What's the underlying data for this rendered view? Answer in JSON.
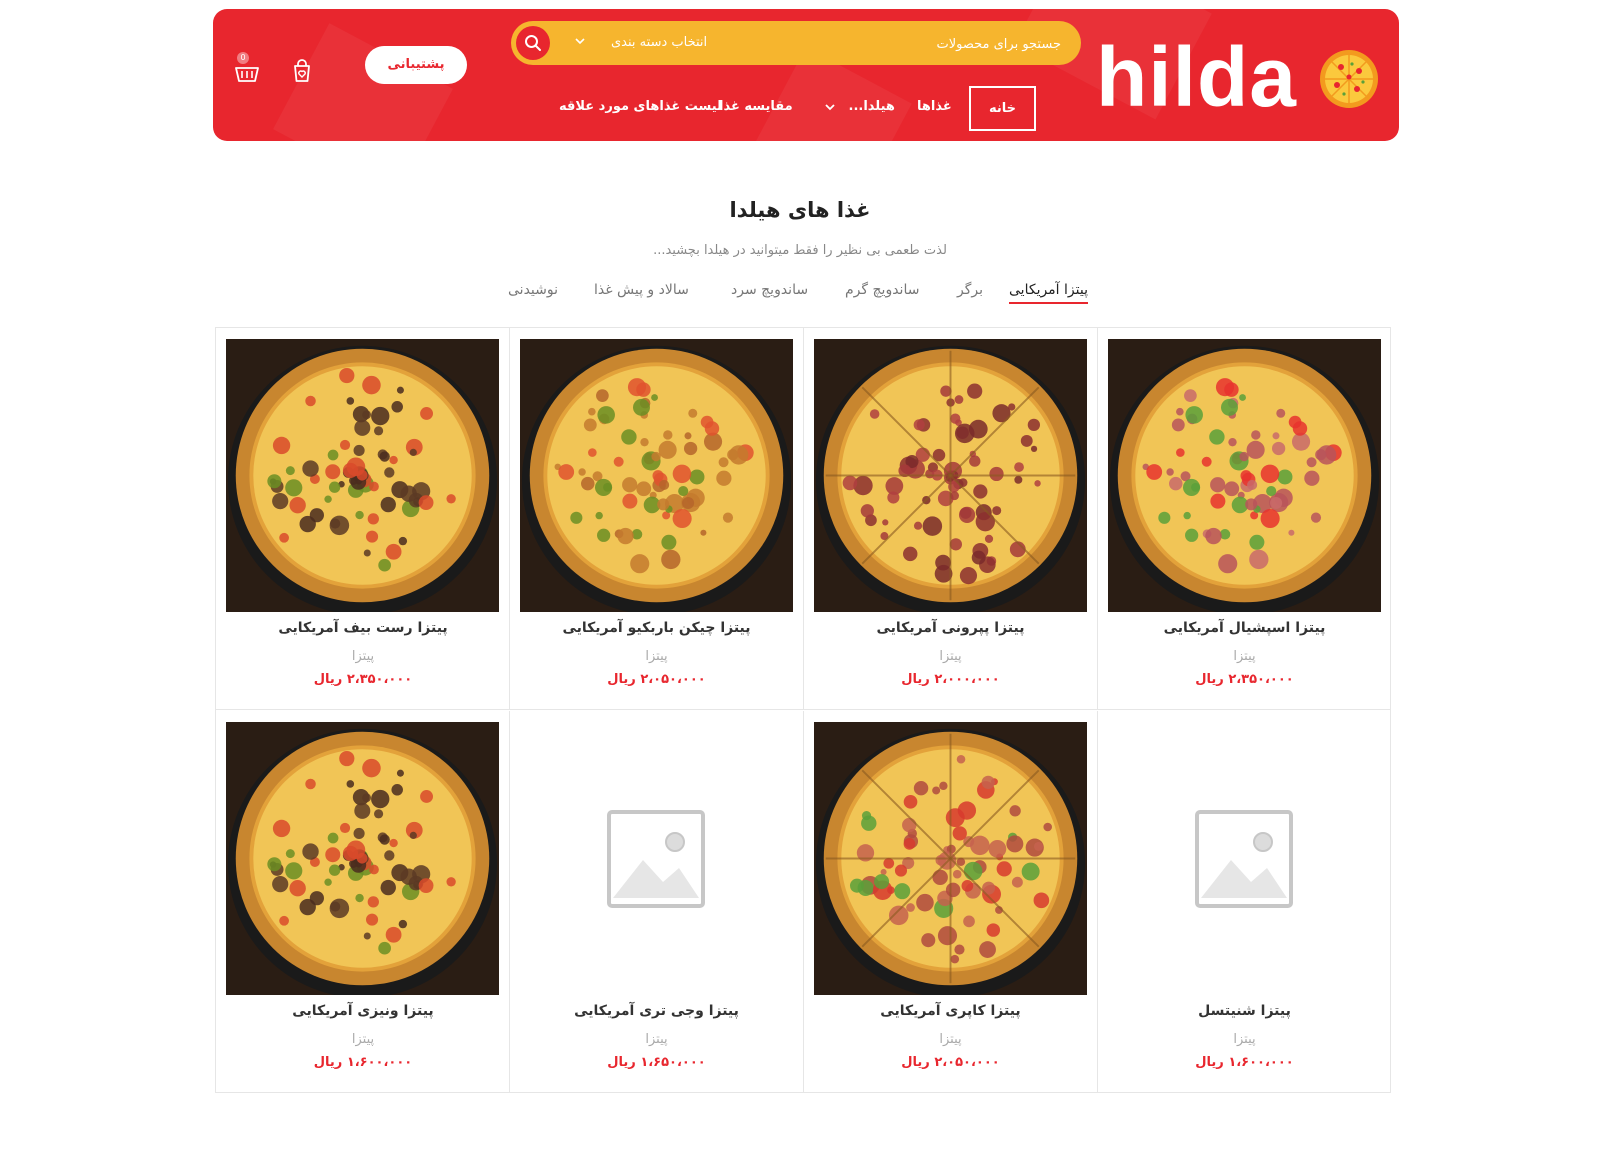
{
  "header": {
    "logo_text": "hilda",
    "search": {
      "placeholder": "جستجو برای محصولات",
      "category_label": "انتخاب دسته بندی"
    },
    "nav": [
      {
        "label": "خانه",
        "active": true
      },
      {
        "label": "غذاها"
      },
      {
        "label": "هیلدا..."
      },
      {
        "label": "مقایسه غذا"
      },
      {
        "label": "لیست غذاهای مورد علاقه"
      }
    ],
    "support_label": "پشتیبانی",
    "cart_count": "0"
  },
  "section": {
    "title": "غذا های هیلدا",
    "subtitle": "لذت طعمی بی نظیر را فقط میتوانید در هیلدا بچشید..."
  },
  "tabs": [
    {
      "label": "پیتزا آمریکایی",
      "active": true
    },
    {
      "label": "برگر"
    },
    {
      "label": "ساندویچ گرم"
    },
    {
      "label": "ساندویچ سرد"
    },
    {
      "label": "سالاد و پیش غذا"
    },
    {
      "label": "نوشیدنی"
    }
  ],
  "products": [
    {
      "title": "پیتزا اسپشیال آمریکایی",
      "category": "پیتزا",
      "price": "۲،۳۵۰،۰۰۰ ریال",
      "image": "pizza-special"
    },
    {
      "title": "پیتزا پپرونی آمریکایی",
      "category": "پیتزا",
      "price": "۲،۰۰۰،۰۰۰ ریال",
      "image": "pizza-pepperoni"
    },
    {
      "title": "پیتزا چیکن باربکیو آمریکایی",
      "category": "پیتزا",
      "price": "۲،۰۵۰،۰۰۰ ریال",
      "image": "pizza-chicken"
    },
    {
      "title": "پیتزا رست بیف آمریکایی",
      "category": "پیتزا",
      "price": "۲،۳۵۰،۰۰۰ ریال",
      "image": "pizza-beef"
    },
    {
      "title": "پیتزا شنیتسل",
      "category": "پیتزا",
      "price": "۱،۶۰۰،۰۰۰ ریال",
      "image": "placeholder"
    },
    {
      "title": "پیتزا کاپری آمریکایی",
      "category": "پیتزا",
      "price": "۲،۰۵۰،۰۰۰ ریال",
      "image": "pizza-capri"
    },
    {
      "title": "پیتزا وجی تری آمریکایی",
      "category": "پیتزا",
      "price": "۱،۶۵۰،۰۰۰ ریال",
      "image": "placeholder"
    },
    {
      "title": "پیتزا ونیزی آمریکایی",
      "category": "پیتزا",
      "price": "۱،۶۰۰،۰۰۰ ریال",
      "image": "pizza-beef"
    }
  ],
  "colors": {
    "brand_red": "#e8262e",
    "search_yellow": "#f6b52e"
  }
}
